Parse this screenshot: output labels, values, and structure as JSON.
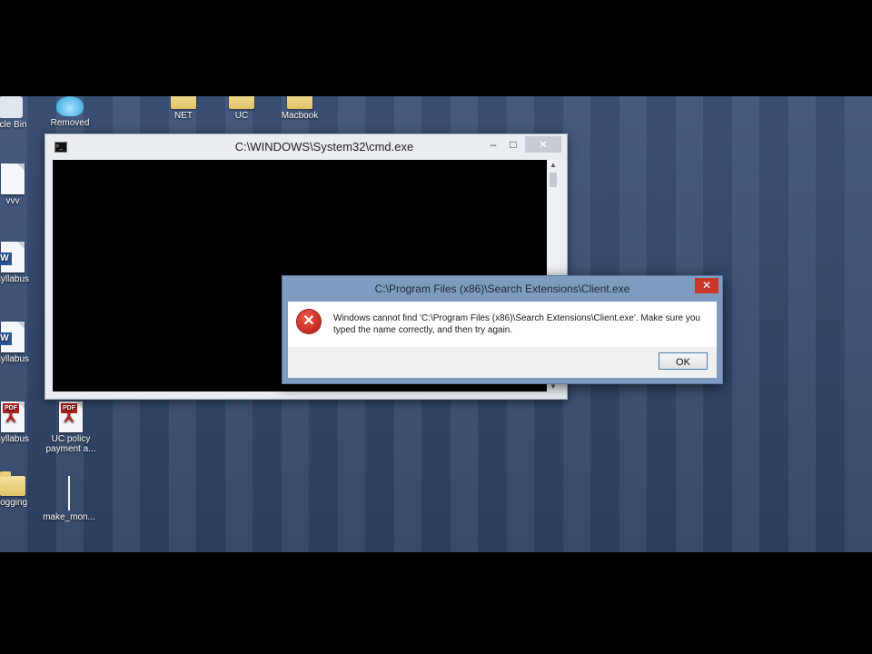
{
  "desktop": {
    "icons_top": [
      {
        "label": "ycle Bin"
      },
      {
        "label": "Removed"
      },
      {
        "label": "NET"
      },
      {
        "label": "UC"
      },
      {
        "label": "Macbook"
      }
    ],
    "icons_left": [
      {
        "label": "vvv"
      },
      {
        "label": "syllabus"
      },
      {
        "label": "syllabus"
      },
      {
        "label": "syllabus"
      },
      {
        "label": "UC policy payment a..."
      },
      {
        "label": "logging"
      },
      {
        "label": "make_mon..."
      }
    ]
  },
  "cmd_window": {
    "title": "C:\\WINDOWS\\System32\\cmd.exe",
    "controls": {
      "minimize": "–",
      "maximize": "□",
      "close": "✕"
    }
  },
  "error_dialog": {
    "title": "C:\\Program Files (x86)\\Search Extensions\\Client.exe",
    "message": "Windows cannot find 'C:\\Program Files (x86)\\Search Extensions\\Client.exe'. Make sure you typed the name correctly, and then try again.",
    "close_glyph": "✕",
    "ok_label": "OK"
  },
  "colors": {
    "desktop_bg": "#3c5378",
    "error_red": "#c7372b",
    "dialog_frame": "#7f9bc0"
  }
}
